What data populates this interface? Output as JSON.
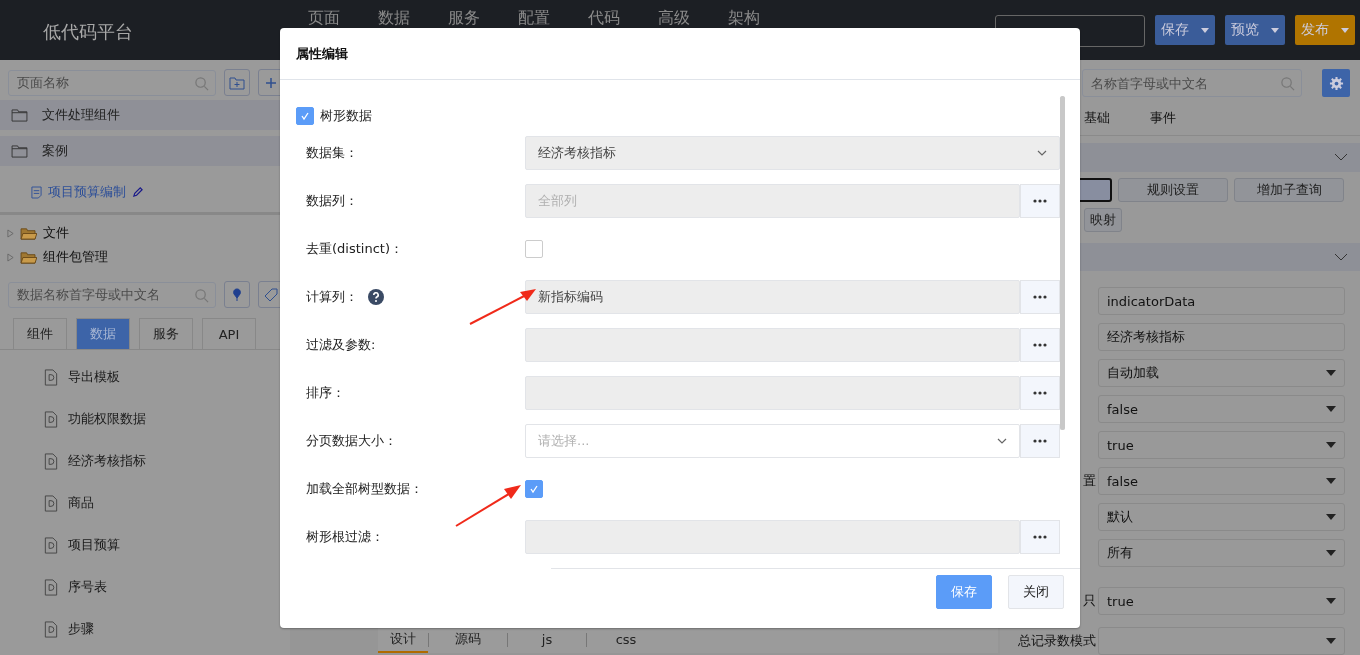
{
  "header": {
    "title": "低代码平台",
    "nav": [
      "页面",
      "数据",
      "服务",
      "配置",
      "代码",
      "高级",
      "架构"
    ],
    "actions": [
      {
        "label": "保存",
        "color": "#3a5c99"
      },
      {
        "label": "预览",
        "color": "#3a5c99"
      },
      {
        "label": "发布",
        "color": "#b07400"
      }
    ]
  },
  "left_panel": {
    "page_search": {
      "placeholder": "页面名称"
    },
    "page_tree": [
      {
        "label": "文件处理组件",
        "kind": "folder",
        "selected": false
      },
      {
        "label": "案例",
        "kind": "folder",
        "selected": false,
        "children": [
          {
            "label": "项目预算编制",
            "kind": "page",
            "selected": true
          }
        ]
      }
    ],
    "package_tree": [
      {
        "label": "文件",
        "expanded": false
      },
      {
        "label": "组件包管理",
        "expanded": false
      }
    ],
    "data_search": {
      "placeholder": "数据名称首字母或中文名"
    },
    "tabs": [
      {
        "label": "组件",
        "selected": false
      },
      {
        "label": "数据",
        "selected": true
      },
      {
        "label": "服务",
        "selected": false
      },
      {
        "label": "API",
        "selected": false
      }
    ],
    "data_items": [
      "导出模板",
      "功能权限数据",
      "经济考核指标",
      "商品",
      "项目预算",
      "序号表",
      "步骤"
    ]
  },
  "bottom_tabs": [
    {
      "label": "设计",
      "selected": true
    },
    {
      "label": "源码",
      "selected": false
    },
    {
      "label": "js",
      "selected": false
    },
    {
      "label": "css",
      "selected": false
    }
  ],
  "right_panel": {
    "search": {
      "placeholder": "名称首字母或中文名"
    },
    "tabs": [
      "基础",
      "事件"
    ],
    "buttons": [
      "规则设置",
      "增加子查询",
      "映射"
    ],
    "fields": [
      {
        "kind": "input",
        "value": "indicatorData"
      },
      {
        "kind": "input",
        "value": "经济考核指标"
      },
      {
        "kind": "select",
        "value": "自动加载"
      },
      {
        "kind": "select",
        "value": "false"
      },
      {
        "kind": "select",
        "value": "true"
      },
      {
        "kind": "select",
        "label": "置",
        "value": "false"
      },
      {
        "kind": "select",
        "value": "默认"
      },
      {
        "kind": "select",
        "value": "所有"
      },
      {
        "kind": "select",
        "label": "只",
        "value": "true"
      },
      {
        "kind": "select",
        "label": "总记录数模式"
      }
    ]
  },
  "modal": {
    "title": "属性编辑",
    "tree_data": {
      "label": "树形数据",
      "checked": true
    },
    "rows": [
      {
        "kind": "select",
        "label": "数据集：",
        "value": "经济考核指标",
        "disabled": true
      },
      {
        "kind": "input",
        "label": "数据列：",
        "placeholder": "全部列",
        "more": true
      },
      {
        "kind": "checkbox",
        "label": "去重(distinct)：",
        "checked": false
      },
      {
        "kind": "input",
        "label": "计算列：",
        "help": true,
        "value": "新指标编码",
        "more": true
      },
      {
        "kind": "input",
        "label": "过滤及参数:",
        "more": true
      },
      {
        "kind": "input",
        "label": "排序：",
        "more": true
      },
      {
        "kind": "select",
        "label": "分页数据大小：",
        "placeholder": "请选择...",
        "disabled": false,
        "more": true
      },
      {
        "kind": "checkbox",
        "label": "加载全部树型数据：",
        "checked": true
      },
      {
        "kind": "input",
        "label": "树形根过滤：",
        "more": true
      }
    ],
    "buttons": [
      {
        "label": "保存",
        "primary": true
      },
      {
        "label": "关闭",
        "primary": false
      }
    ]
  }
}
